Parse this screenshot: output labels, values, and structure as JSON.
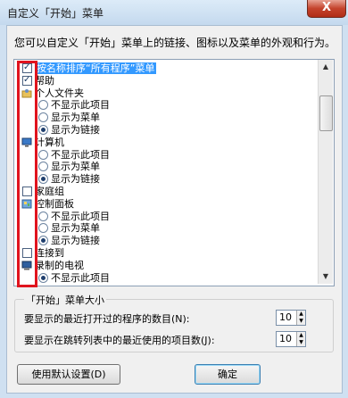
{
  "window": {
    "title": "自定义「开始」菜单",
    "close_glyph": "X"
  },
  "description": "您可以自定义「开始」菜单上的链接、图标以及菜单的外观和行为。",
  "items": [
    {
      "kind": "checkbox",
      "checked": true,
      "label": "按名称排序“所有程序”菜单",
      "selected": true
    },
    {
      "kind": "checkbox",
      "checked": true,
      "label": "帮助"
    },
    {
      "kind": "icon",
      "icon": "user-folder-icon",
      "label": "个人文件夹"
    },
    {
      "kind": "radio",
      "checked": false,
      "label": "不显示此项目"
    },
    {
      "kind": "radio",
      "checked": false,
      "label": "显示为菜单"
    },
    {
      "kind": "radio",
      "checked": true,
      "label": "显示为链接"
    },
    {
      "kind": "icon",
      "icon": "computer-icon",
      "label": "计算机"
    },
    {
      "kind": "radio",
      "checked": false,
      "label": "不显示此项目"
    },
    {
      "kind": "radio",
      "checked": false,
      "label": "显示为菜单"
    },
    {
      "kind": "radio",
      "checked": true,
      "label": "显示为链接"
    },
    {
      "kind": "checkbox",
      "checked": false,
      "label": "家庭组"
    },
    {
      "kind": "icon",
      "icon": "control-panel-icon",
      "label": "控制面板"
    },
    {
      "kind": "radio",
      "checked": false,
      "label": "不显示此项目"
    },
    {
      "kind": "radio",
      "checked": false,
      "label": "显示为菜单"
    },
    {
      "kind": "radio",
      "checked": true,
      "label": "显示为链接"
    },
    {
      "kind": "checkbox",
      "checked": false,
      "label": "连接到"
    },
    {
      "kind": "icon",
      "icon": "tv-icon",
      "label": "录制的电视"
    },
    {
      "kind": "radio",
      "checked": true,
      "label": "不显示此项目"
    }
  ],
  "size_group": {
    "title": "「开始」菜单大小",
    "recent_programs_label": "要显示的最近打开过的程序的数目(N):",
    "recent_programs_value": "10",
    "jump_list_label": "要显示在跳转列表中的最近使用的项目数(J):",
    "jump_list_value": "10"
  },
  "buttons": {
    "defaults": "使用默认设置(D)",
    "ok": "确定"
  },
  "colors": {
    "selection": "#3399ff",
    "highlight_box": "#e0141e"
  }
}
